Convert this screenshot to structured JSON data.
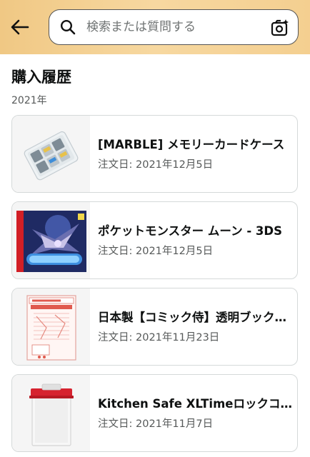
{
  "search": {
    "placeholder": "検索または質問する"
  },
  "page": {
    "title": "購入履歴",
    "year": "2021年"
  },
  "orders": [
    {
      "name": "[MARBLE] メモリーカードケース",
      "date_label": "注文日: ",
      "date": "2021年12月5日"
    },
    {
      "name": "ポケットモンスター ムーン - 3DS",
      "date_label": "注文日: ",
      "date": "2021年12月5日"
    },
    {
      "name": "日本製【コミック侍】透明ブックカバー",
      "date_label": "注文日: ",
      "date": "2021年11月23日"
    },
    {
      "name": "Kitchen Safe XLTimeロックコンテナ",
      "date_label": "注文日: ",
      "date": "2021年11月7日"
    }
  ],
  "colors": {
    "topbar": "#f4cf90",
    "card_border": "#d5d9d9",
    "secondary_text": "#565959"
  },
  "icons": [
    "back-arrow-icon",
    "search-icon",
    "camera-sparkle-icon"
  ]
}
